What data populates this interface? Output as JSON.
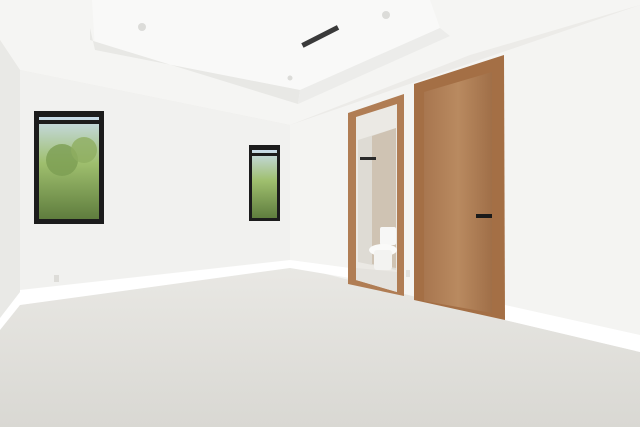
{
  "scene": {
    "kind": "empty-bedroom-interior",
    "elements": {
      "ceiling": "tray-ceiling",
      "left_window": "window",
      "center_window": "window",
      "bathroom_doorway": "open-doorway",
      "closet_door": "wood-door",
      "floor": "light-tile-floor",
      "toilet": "toilet",
      "vent": "air-vent"
    },
    "colors": {
      "wall": "#f2f2f0",
      "wall_shadow": "#e6e6e3",
      "ceiling": "#f6f6f4",
      "floor": "#e2e1dc",
      "wood": "#b07d54",
      "wood_dark": "#8c5f3c",
      "window_frame": "#1c1c1c",
      "foliage": "#7f9f5a",
      "sky": "#b8d0e6"
    }
  }
}
